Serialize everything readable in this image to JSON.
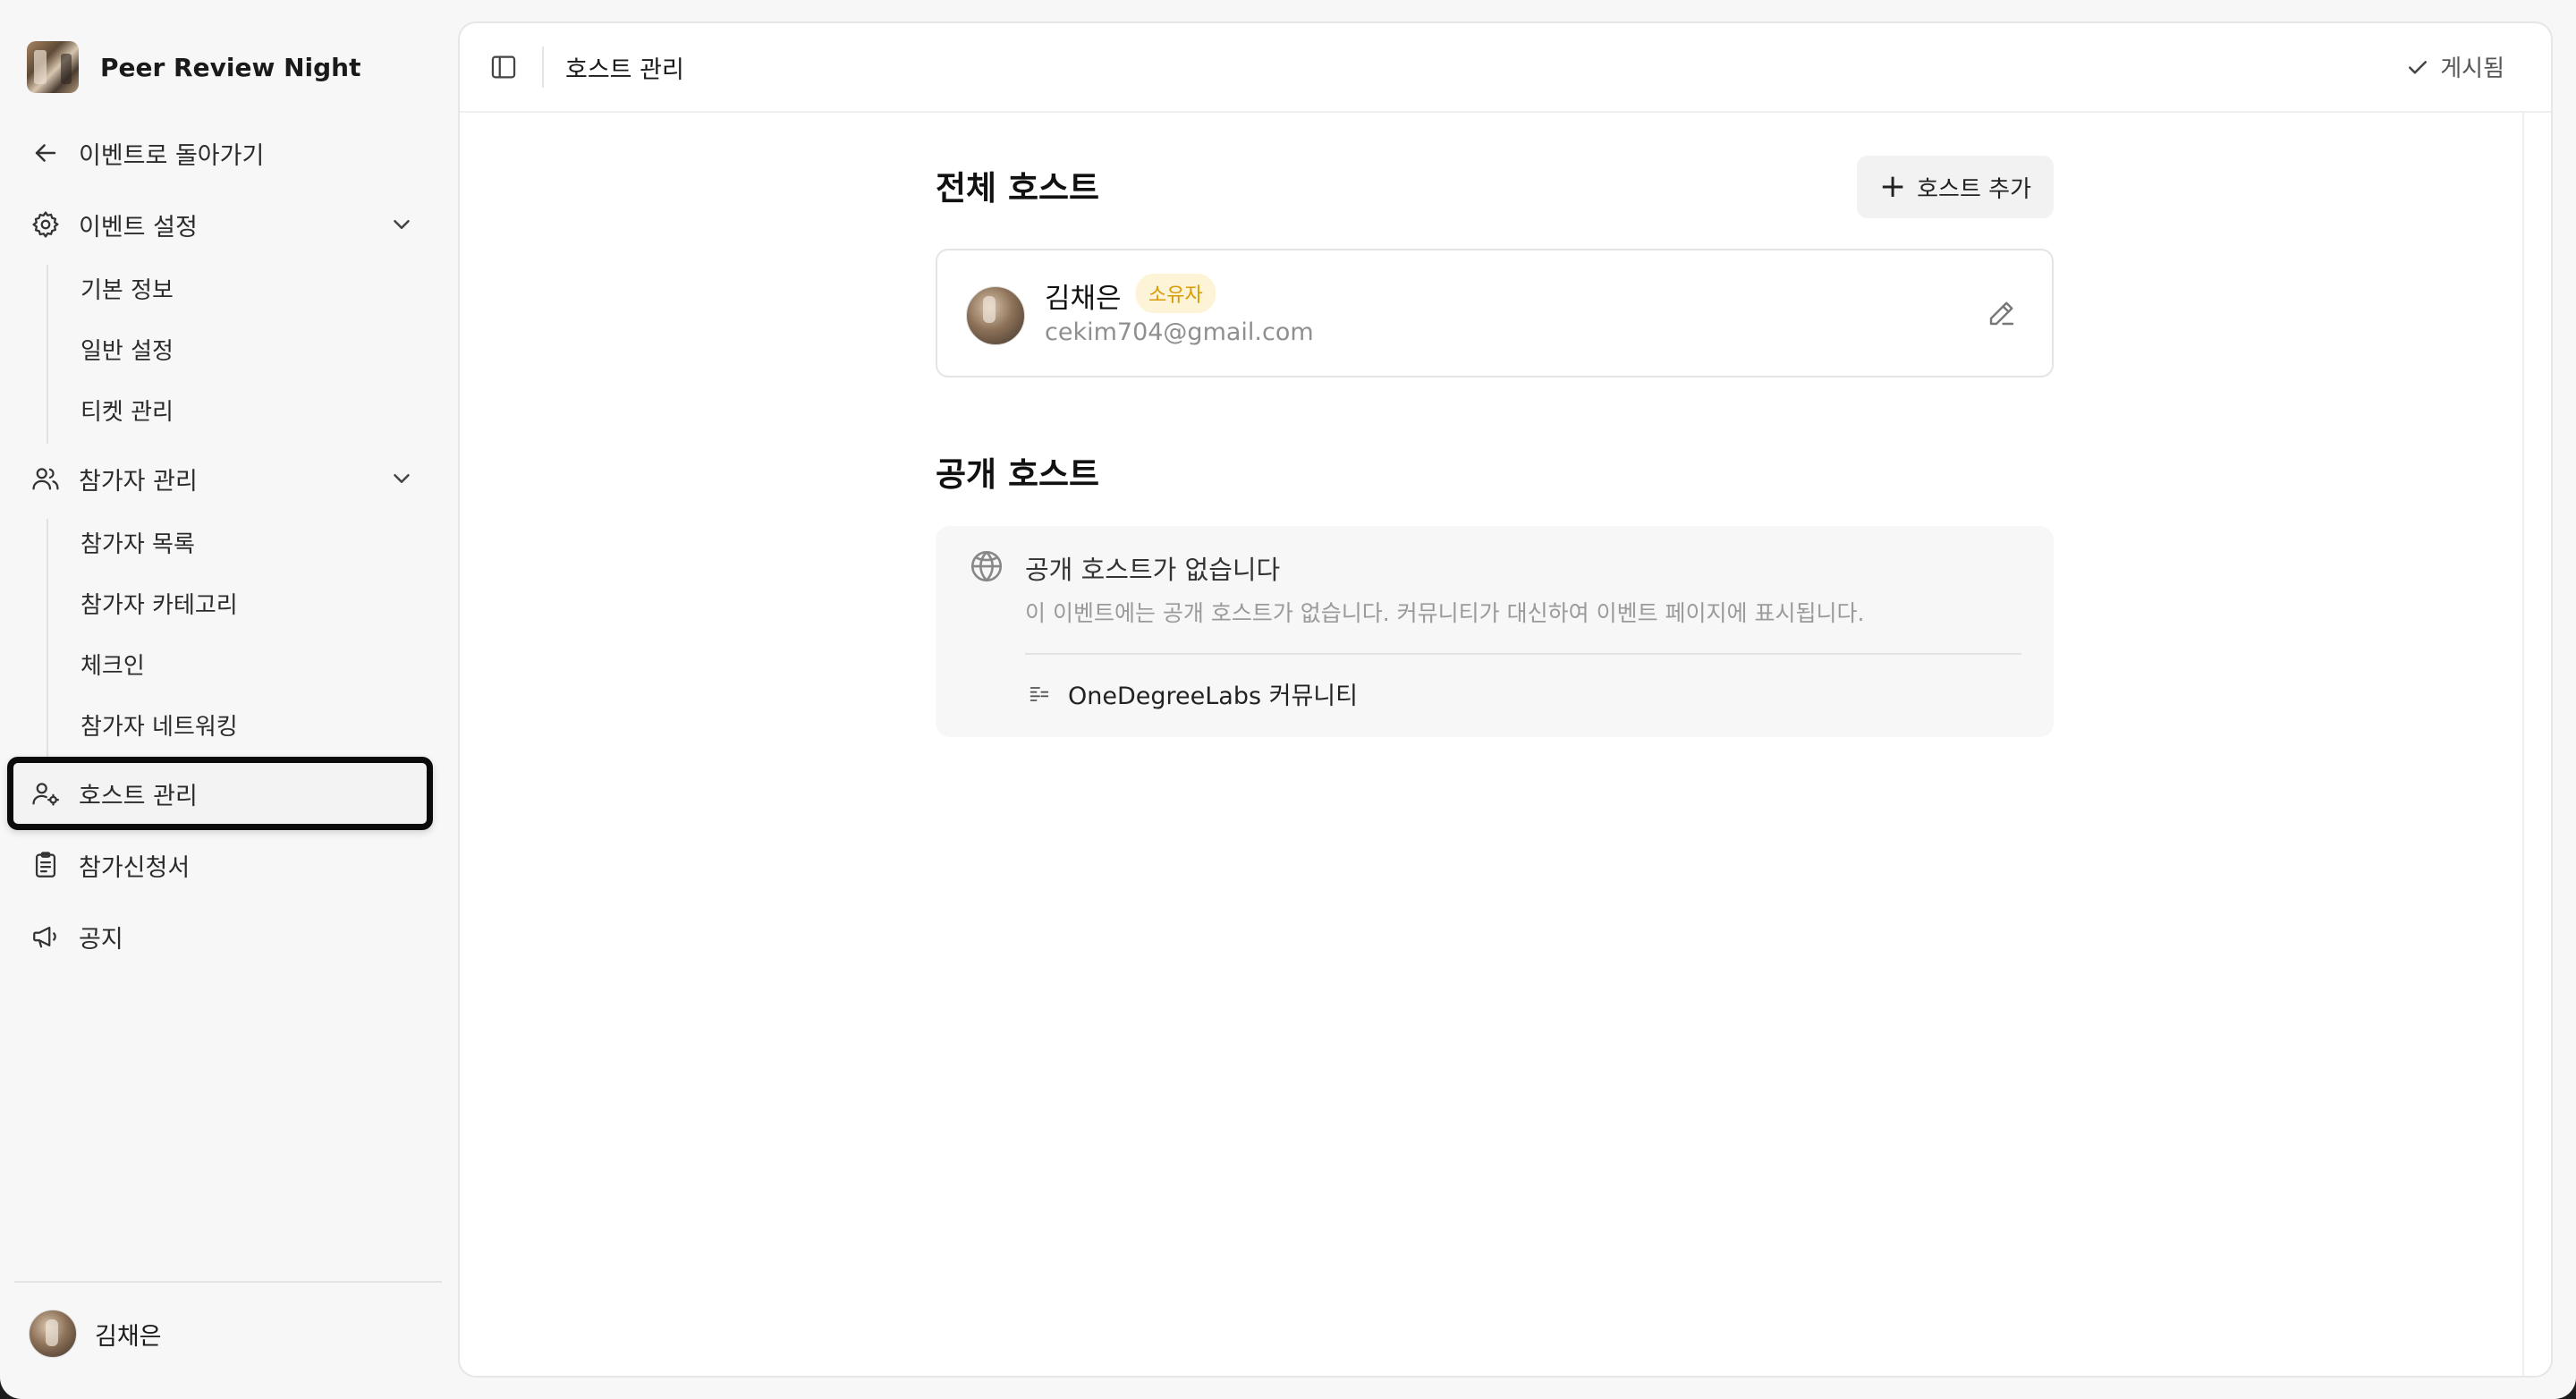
{
  "sidebar": {
    "brand_title": "Peer Review Night",
    "back_label": "이벤트로 돌아가기",
    "event_settings": {
      "label": "이벤트 설정",
      "items": [
        "기본 정보",
        "일반 설정",
        "티켓 관리"
      ]
    },
    "participants": {
      "label": "참가자 관리",
      "items": [
        "참가자 목록",
        "참가자 카테고리",
        "체크인",
        "참가자 네트워킹"
      ]
    },
    "host_manage": "호스트 관리",
    "application_form": "참가신청서",
    "notice": "공지",
    "user_name": "김채은"
  },
  "topbar": {
    "title": "호스트 관리",
    "status": "게시됨"
  },
  "all_hosts": {
    "title": "전체 호스트",
    "add_button": "호스트 추가",
    "hosts": [
      {
        "name": "김채은",
        "role": "소유자",
        "email": "cekim704@gmail.com"
      }
    ]
  },
  "public_hosts": {
    "title": "공개 호스트",
    "empty_title": "공개 호스트가 없습니다",
    "empty_desc": "이 이벤트에는 공개 호스트가 없습니다. 커뮤니티가 대신하여 이벤트 페이지에 표시됩니다.",
    "community": "OneDegreeLabs 커뮤니티"
  },
  "colors": {
    "accent_badge_bg": "#fdf3d6",
    "accent_badge_text": "#d79b06",
    "active_outline": "#0b0b0b"
  }
}
